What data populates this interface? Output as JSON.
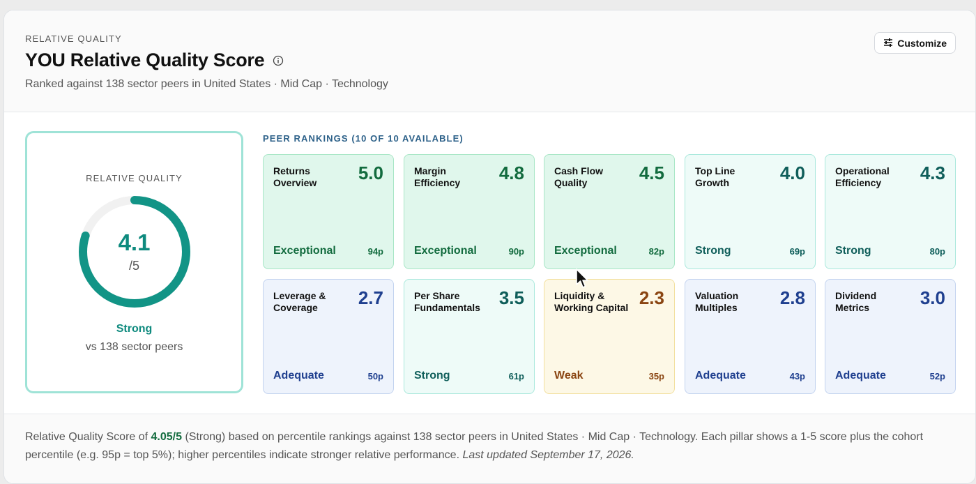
{
  "header": {
    "eyebrow": "RELATIVE QUALITY",
    "title": "YOU Relative Quality Score",
    "subtitle": "Ranked against 138 sector peers in United States · Mid Cap · Technology",
    "customize_label": "Customize"
  },
  "score": {
    "label": "RELATIVE QUALITY",
    "value": "4.1",
    "max": "/5",
    "rating": "Strong",
    "peers": "vs 138 sector peers",
    "fraction": 0.8,
    "ring_color": "#129486",
    "track_color": "#f1f1f1"
  },
  "peer": {
    "heading": "PEER RANKINGS (10 OF 10 AVAILABLE)",
    "tiles": [
      {
        "name": "Returns Overview",
        "score": "5.0",
        "rating": "Exceptional",
        "pct": "94p",
        "tier": "exc"
      },
      {
        "name": "Margin Efficiency",
        "score": "4.8",
        "rating": "Exceptional",
        "pct": "90p",
        "tier": "exc"
      },
      {
        "name": "Cash Flow Quality",
        "score": "4.5",
        "rating": "Exceptional",
        "pct": "82p",
        "tier": "exc"
      },
      {
        "name": "Top Line Growth",
        "score": "4.0",
        "rating": "Strong",
        "pct": "69p",
        "tier": "str"
      },
      {
        "name": "Operational Efficiency",
        "score": "4.3",
        "rating": "Strong",
        "pct": "80p",
        "tier": "str"
      },
      {
        "name": "Leverage & Coverage",
        "score": "2.7",
        "rating": "Adequate",
        "pct": "50p",
        "tier": "ade"
      },
      {
        "name": "Per Share Fundamentals",
        "score": "3.5",
        "rating": "Strong",
        "pct": "61p",
        "tier": "str"
      },
      {
        "name": "Liquidity & Working Capital",
        "score": "2.3",
        "rating": "Weak",
        "pct": "35p",
        "tier": "weak"
      },
      {
        "name": "Valuation Multiples",
        "score": "2.8",
        "rating": "Adequate",
        "pct": "43p",
        "tier": "ade"
      },
      {
        "name": "Dividend Metrics",
        "score": "3.0",
        "rating": "Adequate",
        "pct": "52p",
        "tier": "ade"
      }
    ]
  },
  "footer": {
    "prefix": "Relative Quality Score of ",
    "score": "4.05/5",
    "body": " (Strong) based on percentile rankings against 138 sector peers in United States · Mid Cap · Technology. Each pillar shows a 1-5 score plus the cohort percentile (e.g. 95p = top 5%); higher percentiles indicate stronger relative performance. ",
    "updated": "Last updated September 17, 2026."
  }
}
